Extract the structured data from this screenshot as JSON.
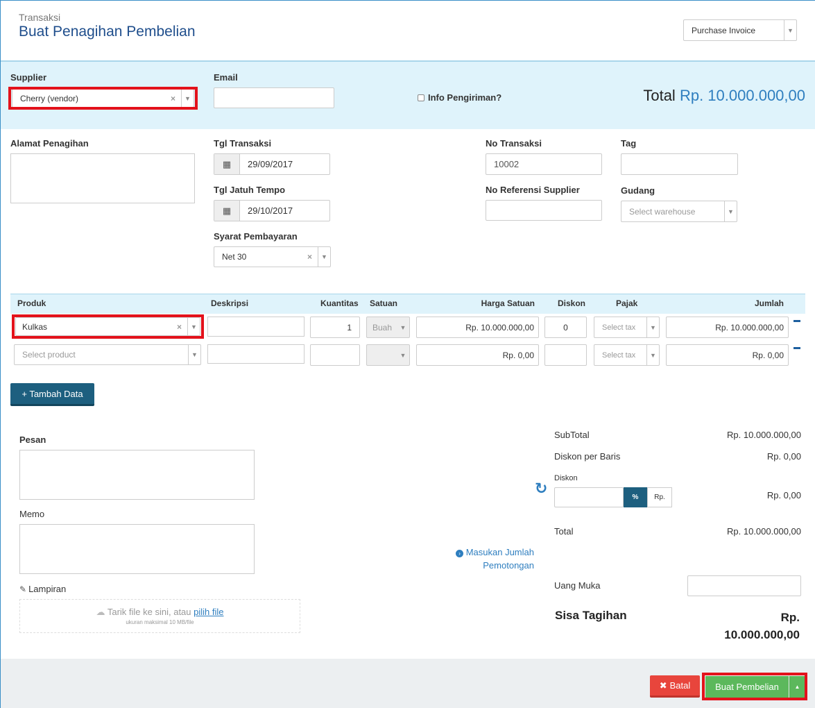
{
  "header": {
    "breadcrumb": "Transaksi",
    "title": "Buat Penagihan Pembelian",
    "doc_type": "Purchase Invoice"
  },
  "top": {
    "supplier_label": "Supplier",
    "supplier_value": "Cherry (vendor)",
    "email_label": "Email",
    "email_value": "",
    "shipping_label": "Info Pengiriman?",
    "total_label": "Total",
    "total_value": "Rp. 10.000.000,00"
  },
  "form": {
    "billing_address_label": "Alamat Penagihan",
    "trans_date_label": "Tgl Transaksi",
    "trans_date_value": "29/09/2017",
    "due_date_label": "Tgl Jatuh Tempo",
    "due_date_value": "29/10/2017",
    "payment_terms_label": "Syarat Pembayaran",
    "payment_terms_value": "Net 30",
    "trans_no_label": "No Transaksi",
    "trans_no_value": "10002",
    "supplier_ref_label": "No Referensi Supplier",
    "tag_label": "Tag",
    "warehouse_label": "Gudang",
    "warehouse_placeholder": "Select warehouse"
  },
  "table": {
    "headers": {
      "product": "Produk",
      "description": "Deskripsi",
      "quantity": "Kuantitas",
      "unit": "Satuan",
      "unit_price": "Harga Satuan",
      "discount": "Diskon",
      "tax": "Pajak",
      "amount": "Jumlah"
    },
    "rows": [
      {
        "product": "Kulkas",
        "quantity": "1",
        "unit": "Buah",
        "unit_price": "Rp. 10.000.000,00",
        "discount": "0",
        "tax": "Select tax",
        "amount": "Rp. 10.000.000,00"
      },
      {
        "product": "Select product",
        "quantity": "",
        "unit": "",
        "unit_price": "Rp. 0,00",
        "discount": "",
        "tax": "Select tax",
        "amount": "Rp. 0,00"
      }
    ],
    "add_button": "+ Tambah Data"
  },
  "bottom": {
    "message_label": "Pesan",
    "memo_label": "Memo",
    "attachment_label": "Lampiran",
    "drop_text": "Tarik file ke sini, atau",
    "drop_link": "pilih file",
    "drop_hint": "ukuran maksimal 10 MB/file",
    "withholding_link_line1": "Masukan Jumlah",
    "withholding_link_line2": "Pemotongan"
  },
  "summary": {
    "subtotal_label": "SubTotal",
    "subtotal_value": "Rp. 10.000.000,00",
    "line_discount_label": "Diskon per Baris",
    "line_discount_value": "Rp. 0,00",
    "discount_label": "Diskon",
    "discount_pct": "%",
    "discount_rp": "Rp.",
    "discount_value": "Rp. 0,00",
    "total_label": "Total",
    "total_value": "Rp. 10.000.000,00",
    "down_payment_label": "Uang Muka",
    "balance_label": "Sisa Tagihan",
    "balance_value_line1": "Rp.",
    "balance_value_line2": "10.000.000,00"
  },
  "footer": {
    "cancel_label": "Batal",
    "submit_label": "Buat Pembelian"
  },
  "colors": {
    "title": "#1f4e8c",
    "accent": "#1d5f7f",
    "total_value": "#2e7ebf",
    "band": "#dff3fb",
    "cancel": "#e8453c",
    "submit": "#5cb85c",
    "highlight": "#e3121b"
  }
}
